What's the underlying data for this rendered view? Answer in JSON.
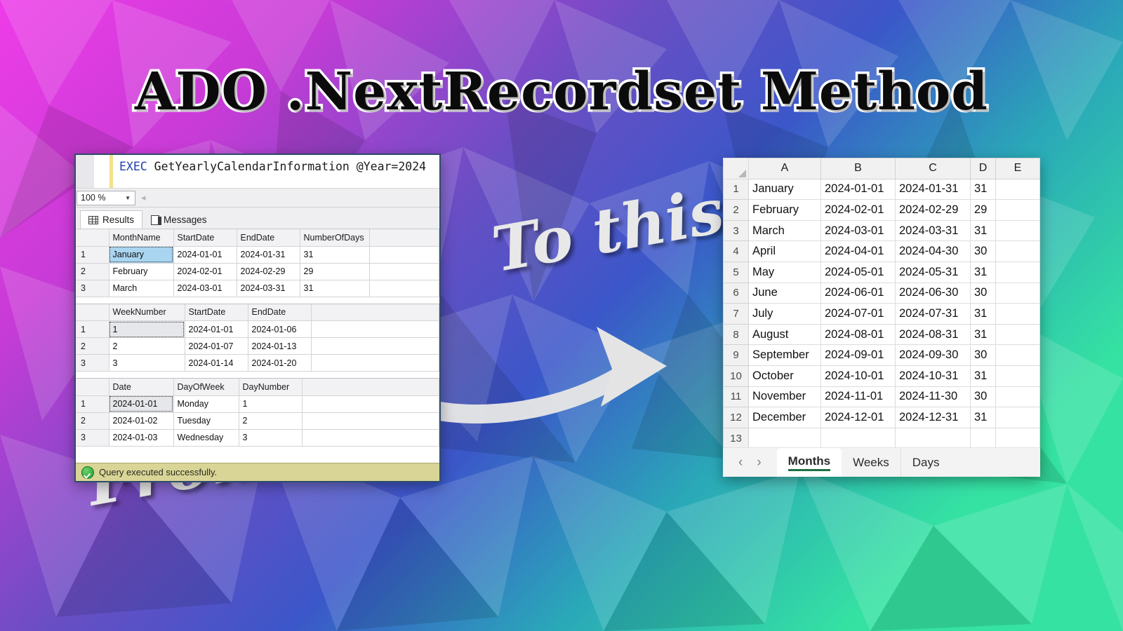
{
  "title": "ADO .NextRecordset Method",
  "captions": {
    "from": "From this",
    "to": "To this"
  },
  "colors": {
    "accent_green": "#1d7044",
    "sql_keyword": "#1f3fb0",
    "selection_blue": "#aad5f0",
    "status_bar": "#d9d597",
    "bg_left": "#e43ce0",
    "bg_mid": "#3b46c8",
    "bg_right": "#2fd9a8"
  },
  "ssms": {
    "editor": {
      "keyword": "EXEC",
      "statement": " GetYearlyCalendarInformation @Year=2024"
    },
    "zoom": {
      "value": "100 %",
      "caret": "▼"
    },
    "tabs": [
      {
        "label": "Results",
        "icon": "results-grid-icon",
        "active": true
      },
      {
        "label": "Messages",
        "icon": "messages-icon",
        "active": false
      }
    ],
    "status": {
      "icon": "success-check-icon",
      "text": "Query executed successfully."
    },
    "resultsets": [
      {
        "name": "months",
        "columns": [
          "MonthName",
          "StartDate",
          "EndDate",
          "NumberOfDays"
        ],
        "rows": [
          {
            "n": "1",
            "cells": [
              "January",
              "2024-01-01",
              "2024-01-31",
              "31"
            ]
          },
          {
            "n": "2",
            "cells": [
              "February",
              "2024-02-01",
              "2024-02-29",
              "29"
            ]
          },
          {
            "n": "3",
            "cells": [
              "March",
              "2024-03-01",
              "2024-03-31",
              "31"
            ]
          }
        ]
      },
      {
        "name": "weeks",
        "columns": [
          "WeekNumber",
          "StartDate",
          "EndDate"
        ],
        "rows": [
          {
            "n": "1",
            "cells": [
              "1",
              "2024-01-01",
              "2024-01-06"
            ]
          },
          {
            "n": "2",
            "cells": [
              "2",
              "2024-01-07",
              "2024-01-13"
            ]
          },
          {
            "n": "3",
            "cells": [
              "3",
              "2024-01-14",
              "2024-01-20"
            ]
          }
        ]
      },
      {
        "name": "days",
        "columns": [
          "Date",
          "DayOfWeek",
          "DayNumber"
        ],
        "rows": [
          {
            "n": "1",
            "cells": [
              "2024-01-01",
              "Monday",
              "1"
            ]
          },
          {
            "n": "2",
            "cells": [
              "2024-01-02",
              "Tuesday",
              "2"
            ]
          },
          {
            "n": "3",
            "cells": [
              "2024-01-03",
              "Wednesday",
              "3"
            ]
          }
        ]
      }
    ]
  },
  "excel": {
    "column_headers": [
      "A",
      "B",
      "C",
      "D",
      "E"
    ],
    "row_headers": [
      "1",
      "2",
      "3",
      "4",
      "5",
      "6",
      "7",
      "8",
      "9",
      "10",
      "11",
      "12",
      "13"
    ],
    "rows": [
      [
        "January",
        "2024-01-01",
        "2024-01-31",
        "31",
        ""
      ],
      [
        "February",
        "2024-02-01",
        "2024-02-29",
        "29",
        ""
      ],
      [
        "March",
        "2024-03-01",
        "2024-03-31",
        "31",
        ""
      ],
      [
        "April",
        "2024-04-01",
        "2024-04-30",
        "30",
        ""
      ],
      [
        "May",
        "2024-05-01",
        "2024-05-31",
        "31",
        ""
      ],
      [
        "June",
        "2024-06-01",
        "2024-06-30",
        "30",
        ""
      ],
      [
        "July",
        "2024-07-01",
        "2024-07-31",
        "31",
        ""
      ],
      [
        "August",
        "2024-08-01",
        "2024-08-31",
        "31",
        ""
      ],
      [
        "September",
        "2024-09-01",
        "2024-09-30",
        "30",
        ""
      ],
      [
        "October",
        "2024-10-01",
        "2024-10-31",
        "31",
        ""
      ],
      [
        "November",
        "2024-11-01",
        "2024-11-30",
        "30",
        ""
      ],
      [
        "December",
        "2024-12-01",
        "2024-12-31",
        "31",
        ""
      ],
      [
        "",
        "",
        "",
        "",
        ""
      ]
    ],
    "nav": {
      "prev": "‹",
      "next": "›"
    },
    "sheet_tabs": [
      {
        "label": "Months",
        "active": true
      },
      {
        "label": "Weeks",
        "active": false
      },
      {
        "label": "Days",
        "active": false
      }
    ]
  }
}
